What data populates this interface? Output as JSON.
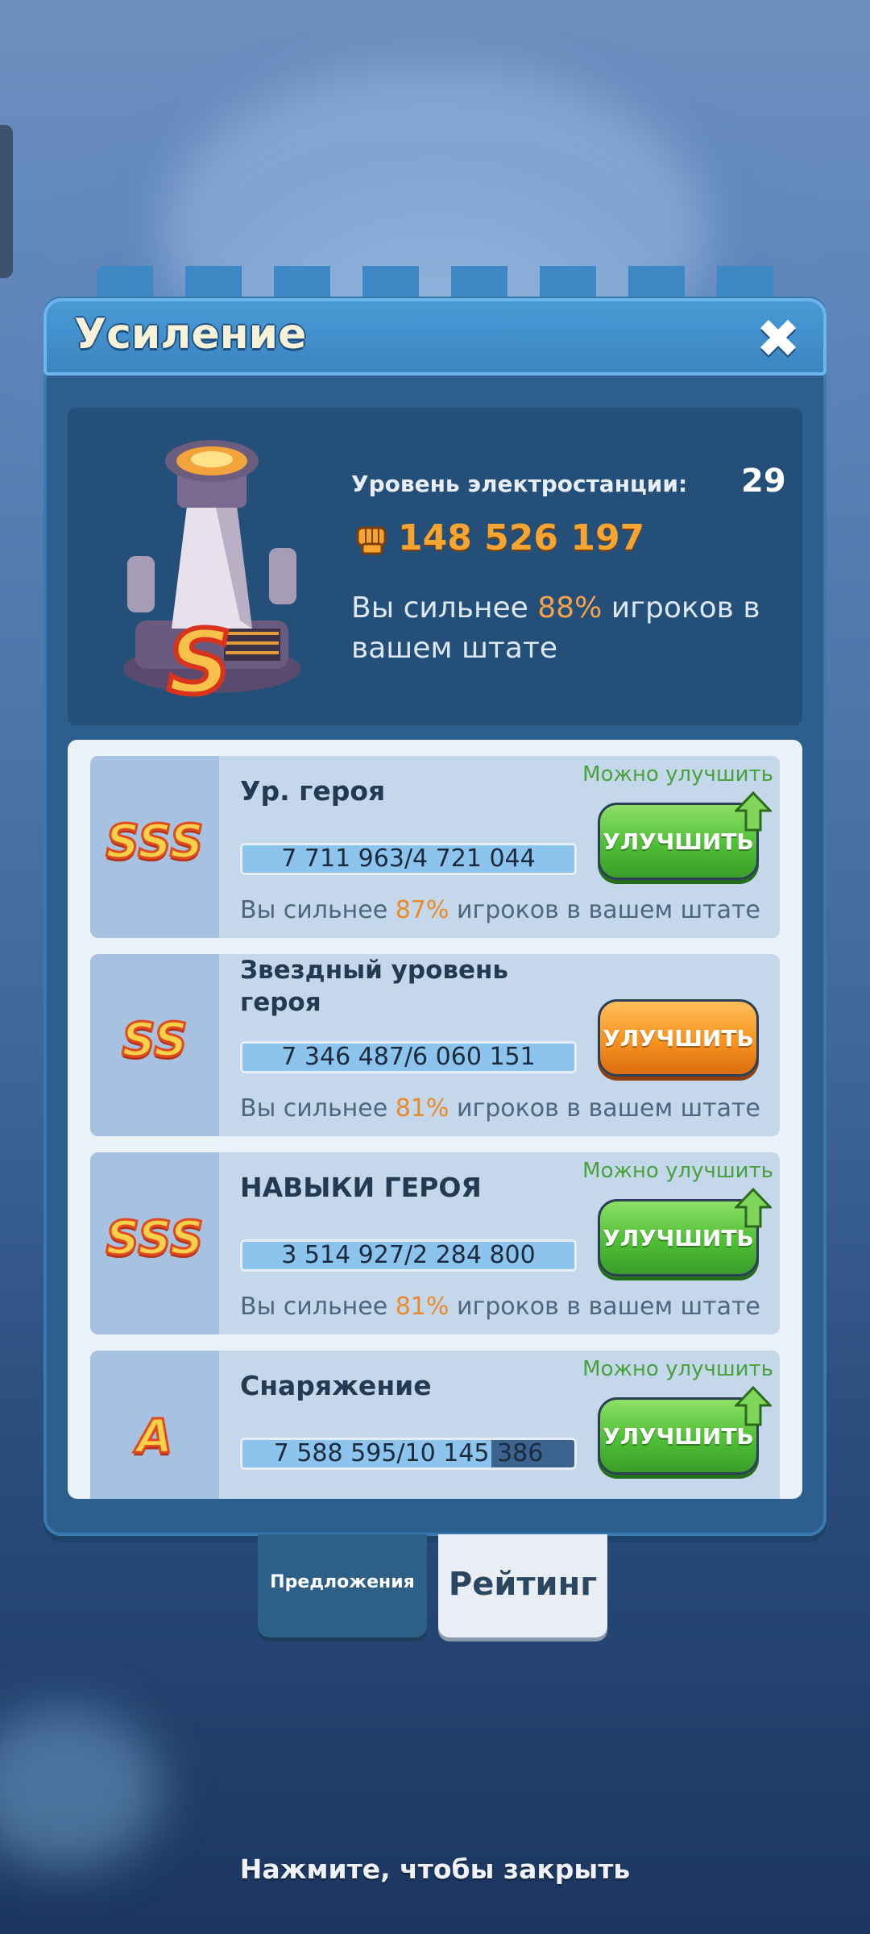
{
  "header": {
    "title": "Усиление",
    "close_icon": "close-icon"
  },
  "summary": {
    "level_label": "Уровень электростанции:",
    "level_value": "29",
    "power_icon": "fist-icon",
    "power_value": "148 526 197",
    "text_prefix": "Вы сильнее ",
    "text_percent": "88%",
    "text_suffix": " игроков в вашем штате"
  },
  "cards": [
    {
      "grade": "SSS",
      "title": "Ур. героя",
      "progress": "7 711 963/4 721 044",
      "progress_fraction": 1.0,
      "stat_prefix": "Вы сильнее ",
      "stat_percent": "87%",
      "stat_suffix": " игроков в вашем штате",
      "can_upgrade": "Можно улучшить",
      "button": "УЛУЧШИТЬ",
      "button_color": "green"
    },
    {
      "grade": "SS",
      "title": "Звездный уровень героя",
      "progress": "7 346 487/6 060 151",
      "progress_fraction": 1.0,
      "stat_prefix": "Вы сильнее ",
      "stat_percent": "81%",
      "stat_suffix": " игроков в вашем штате",
      "button": "УЛУЧШИТЬ",
      "button_color": "orange"
    },
    {
      "grade": "SSS",
      "title": "НАВЫКИ ГЕРОЯ",
      "progress": "3 514 927/2 284 800",
      "progress_fraction": 1.0,
      "stat_prefix": "Вы сильнее ",
      "stat_percent": "81%",
      "stat_suffix": " игроков в вашем штате",
      "can_upgrade": "Можно улучшить",
      "button": "УЛУЧШИТЬ",
      "button_color": "green"
    },
    {
      "grade": "A",
      "title": "Снаряжение",
      "progress": "7 588 595/10 145 386",
      "progress_fraction": 0.75,
      "can_upgrade": "Можно улучшить",
      "button": "УЛУЧШИТЬ",
      "button_color": "green"
    }
  ],
  "tabs": {
    "offers": "Предложения",
    "rating": "Рейтинг"
  },
  "footer": {
    "tap_to_close": "Нажмите, чтобы закрыть"
  },
  "colors": {
    "accent_orange": "#f6a24a",
    "button_green": "#4fbe36",
    "button_orange": "#f7931f",
    "panel_blue": "#2c5f8e"
  }
}
